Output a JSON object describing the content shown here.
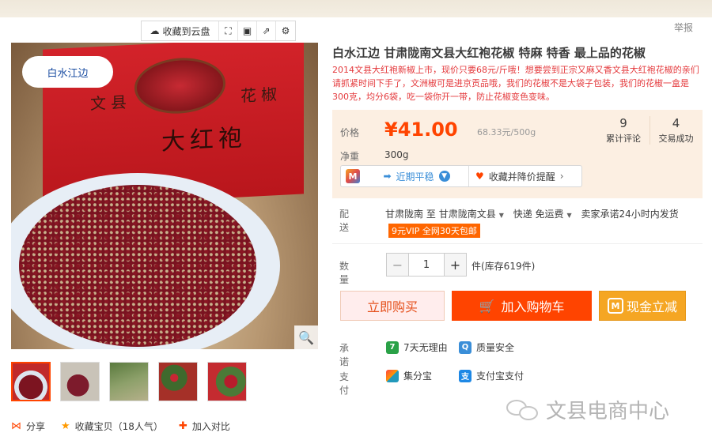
{
  "header": {
    "report_link": "举报"
  },
  "cloud_toolbar": {
    "save_label": "收藏到云盘"
  },
  "product_image": {
    "box_logo_text": "白水江边",
    "box_text_left": "文县",
    "box_text_right": "花椒",
    "box_text_center": "大红袍"
  },
  "thumbnails": [
    "thumb-1",
    "thumb-2",
    "thumb-3",
    "thumb-4",
    "thumb-5"
  ],
  "bottom_actions": {
    "share": "分享",
    "favorite": "收藏宝贝（18人气）",
    "compare": "加入对比"
  },
  "product": {
    "title": "白水江边 甘肃陇南文县大红袍花椒 特麻 特香 最上品的花椒",
    "subtitle": "2014文县大红袍新椒上市，现价只要68元/斤哦！想要尝到正宗又麻又香文县大红袍花椒的亲们请抓紧时间下手了，文洲椒可是进京贡品哦，我们的花椒不是大袋子包装，我们的花椒一盒是300克，均分6袋，吃一袋你开一带，防止花椒变色变味。"
  },
  "price": {
    "label": "价格",
    "value": "¥41.00",
    "unit_price": "68.33元/500g",
    "reviews_count": "9",
    "reviews_label": "累计评论",
    "deals_count": "4",
    "deals_label": "交易成功"
  },
  "weight": {
    "label": "净重",
    "value": "300g"
  },
  "trend_bar": {
    "trend_label": "近期平稳",
    "favorite_alert_label": "收藏并降价提醒"
  },
  "shipping": {
    "label": "配送",
    "from": "甘肃陇南",
    "to_word": "至",
    "to": "甘肃陇南文县",
    "method": "快递 免运费",
    "promise": "卖家承诺24小时内发货",
    "vip_badge": "9元VIP 全网30天包邮"
  },
  "quantity": {
    "label": "数量",
    "value": "1",
    "minus": "−",
    "plus": "+",
    "stock": "件(库存619件)"
  },
  "buttons": {
    "buy_now": "立即购买",
    "add_cart": "加入购物车",
    "cash_discount": "现金立减"
  },
  "commitment": {
    "label": "承诺",
    "no_reason": "7天无理由",
    "quality": "质量安全"
  },
  "payment": {
    "label": "支付",
    "jifenbao": "集分宝",
    "alipay": "支付宝支付"
  },
  "watermark": {
    "text": "文县电商中心"
  },
  "colors": {
    "accent": "#ff4400",
    "price_bg": "#fcefe2",
    "cash_btn": "#f5a623"
  }
}
